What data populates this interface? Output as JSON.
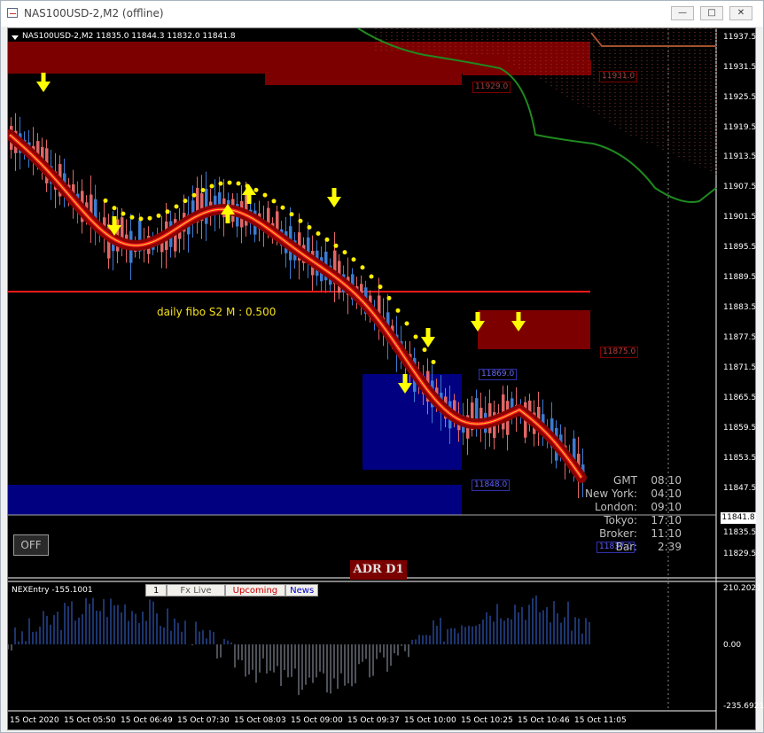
{
  "window": {
    "title": "NAS100USD-2,M2 (offline)",
    "controls": [
      "minimize",
      "maximize",
      "close"
    ]
  },
  "chart": {
    "header": "NAS100USD-2,M2  11835.0 11844.3 11832.0 11841.8",
    "current_price": "11841.8",
    "price_axis": [
      "11937.5",
      "11931.5",
      "11925.5",
      "11919.5",
      "11913.5",
      "11907.5",
      "11901.5",
      "11895.5",
      "11889.5",
      "11883.5",
      "11877.5",
      "11871.5",
      "11865.5",
      "11859.5",
      "11853.5",
      "11847.5",
      "11841.5",
      "11835.5",
      "11829.5"
    ],
    "time_axis": [
      "15 Oct 2020",
      "15 Oct 05:50",
      "15 Oct 06:49",
      "15 Oct 07:30",
      "15 Oct 08:03",
      "15 Oct 09:00",
      "15 Oct 09:37",
      "15 Oct 10:00",
      "15 Oct 10:25",
      "15 Oct 10:46",
      "15 Oct 11:05"
    ],
    "zones": {
      "top_red_1": "11929.0",
      "top_red_2": "11931.0",
      "mid_red": "11875.0",
      "blue_small": "11869.0",
      "blue_big": "11848.0",
      "bottom_small": "11837.0"
    },
    "fibo_label": "daily fibo S2 M : 0.500",
    "off_button": "OFF",
    "adr_label": "ADR D1",
    "clock": [
      {
        "label": "GMT",
        "value": "08:10"
      },
      {
        "label": "New York:",
        "value": "04:10"
      },
      {
        "label": "London:",
        "value": "09:10"
      },
      {
        "label": "Tokyo:",
        "value": "17:10"
      },
      {
        "label": "Broker:",
        "value": "11:10"
      },
      {
        "label": "Bar:",
        "value": "2:39"
      }
    ]
  },
  "indicator": {
    "title": "NEXEntry -155.1001",
    "axis": [
      "210.2021",
      "0.00",
      "-235.6921"
    ],
    "tabs": [
      {
        "label": "1",
        "color": "#000000"
      },
      {
        "label": "Fx Live",
        "color": "#555555"
      },
      {
        "label": "Upcoming",
        "color": "#cc0000"
      },
      {
        "label": "News",
        "color": "#0000cc"
      }
    ]
  },
  "colors": {
    "bull_candle": "#3d7bd1",
    "bear_candle": "#e06666",
    "ma_line": "#ff2020",
    "ma_glow": "#8b0000",
    "dots": "#ffee00",
    "support_line": "#ff1a1a",
    "red_zone": "#7d0000",
    "blue_zone": "#000080",
    "green_line": "#1f8a1f",
    "arrow": "#ffff00"
  }
}
